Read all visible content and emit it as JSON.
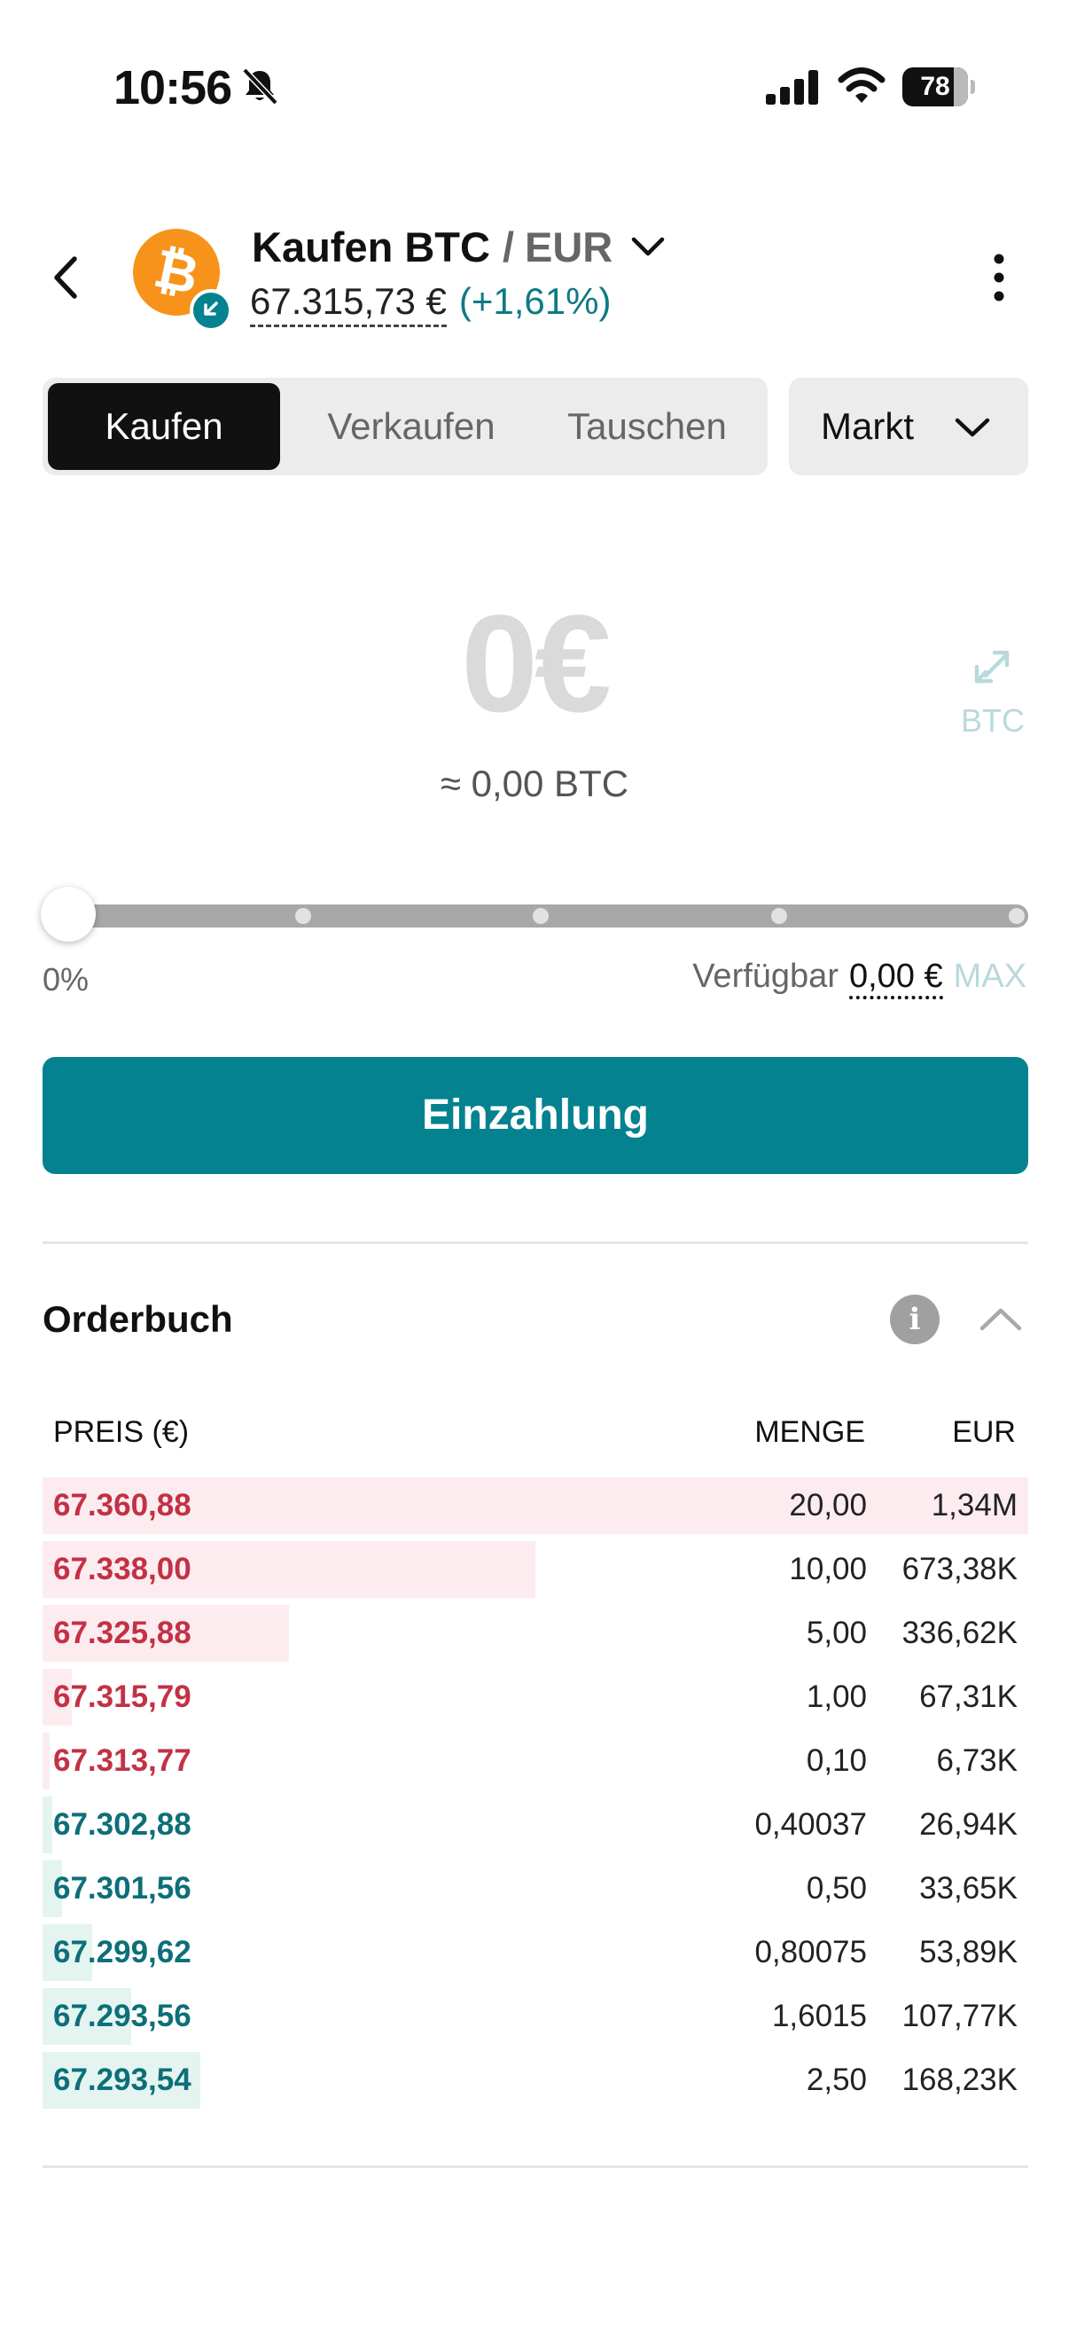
{
  "status_bar": {
    "time": "10:56",
    "battery_level": "78",
    "battery_fraction": 0.78,
    "icons": [
      "bell-slash-icon",
      "cellular-signal-icon",
      "wifi-icon",
      "battery-icon"
    ]
  },
  "header": {
    "action": "Kaufen BTC",
    "separator": "/",
    "quote": "EUR",
    "price": "67.315,73 €",
    "change": "(+1,61%)",
    "coin_logo_letter": "₿",
    "icons": [
      "back-chevron-icon",
      "bitcoin-logo-icon",
      "deposit-badge-icon",
      "pair-chevron-down-icon",
      "more-vertical-icon"
    ]
  },
  "tabs": [
    {
      "label": "Kaufen",
      "active": true
    },
    {
      "label": "Verkaufen",
      "active": false
    },
    {
      "label": "Tauschen",
      "active": false
    }
  ],
  "order_type": {
    "label": "Markt",
    "icon": "chevron-down-icon"
  },
  "amount": {
    "value": "0€",
    "converted": "≈ 0,00 BTC",
    "swap_label": "BTC",
    "swap_icon": "swap-arrows-icon"
  },
  "slider": {
    "percent_label": "0%",
    "value_fraction": 0,
    "steps": [
      0,
      0.25,
      0.5,
      0.75,
      1
    ]
  },
  "available": {
    "label": "Verfügbar",
    "value": "0,00 €",
    "max_label": "MAX"
  },
  "deposit_button": {
    "label": "Einzahlung"
  },
  "orderbook": {
    "title": "Orderbuch",
    "info_icon": "info-icon",
    "collapse_icon": "chevron-up-icon",
    "columns": {
      "price": "PREIS (€)",
      "qty": "MENGE",
      "eur": "EUR"
    },
    "rows": [
      {
        "side": "ask",
        "price": "67.360,88",
        "qty": "20,00",
        "eur": "1,34M",
        "depth": 1.0
      },
      {
        "side": "ask",
        "price": "67.338,00",
        "qty": "10,00",
        "eur": "673,38K",
        "depth": 0.5
      },
      {
        "side": "ask",
        "price": "67.325,88",
        "qty": "5,00",
        "eur": "336,62K",
        "depth": 0.25
      },
      {
        "side": "ask",
        "price": "67.315,79",
        "qty": "1,00",
        "eur": "67,31K",
        "depth": 0.03
      },
      {
        "side": "ask",
        "price": "67.313,77",
        "qty": "0,10",
        "eur": "6,73K",
        "depth": 0.006
      },
      {
        "side": "bid",
        "price": "67.302,88",
        "qty": "0,40037",
        "eur": "26,94K",
        "depth": 0.01
      },
      {
        "side": "bid",
        "price": "67.301,56",
        "qty": "0,50",
        "eur": "33,65K",
        "depth": 0.02
      },
      {
        "side": "bid",
        "price": "67.299,62",
        "qty": "0,80075",
        "eur": "53,89K",
        "depth": 0.05
      },
      {
        "side": "bid",
        "price": "67.293,56",
        "qty": "1,6015",
        "eur": "107,77K",
        "depth": 0.09
      },
      {
        "side": "bid",
        "price": "67.293,54",
        "qty": "2,50",
        "eur": "168,23K",
        "depth": 0.16
      }
    ]
  },
  "colors": {
    "accent": "#048290",
    "ask": "#c23145",
    "bid": "#0d6f78",
    "ask_bar": "#fdecef",
    "bid_bar": "#e4f4f1",
    "bitcoin": "#f7931a"
  }
}
